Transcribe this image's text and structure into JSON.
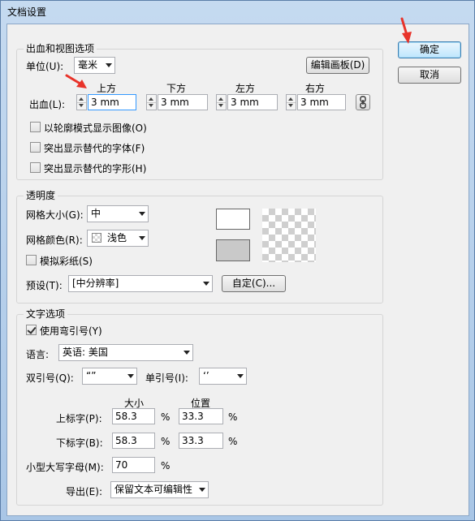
{
  "window": {
    "title": "文档设置"
  },
  "buttons": {
    "ok": "确定",
    "cancel": "取消",
    "edit_artboards": "编辑画板(D)",
    "custom": "自定(C)..."
  },
  "bleed_section": {
    "legend": "出血和视图选项",
    "units_label": "单位(U):",
    "units_value": "毫米",
    "bleed_label": "出血(L):",
    "top_label": "上方",
    "bottom_label": "下方",
    "left_label": "左方",
    "right_label": "右方",
    "top_value": "3 mm",
    "bottom_value": "3 mm",
    "left_value": "3 mm",
    "right_value": "3 mm",
    "outline_images": "以轮廓模式显示图像(O)",
    "highlight_fonts": "突出显示替代的字体(F)",
    "highlight_glyphs": "突出显示替代的字形(H)"
  },
  "transparency_section": {
    "legend": "透明度",
    "grid_size_label": "网格大小(G):",
    "grid_size_value": "中",
    "grid_color_label": "网格颜色(R):",
    "grid_color_value": "浅色",
    "simulate_paper": "模拟彩纸(S)",
    "preset_label": "预设(T):",
    "preset_value": "[中分辨率]"
  },
  "type_section": {
    "legend": "文字选项",
    "use_typographers_quotes": "使用弯引号(Y)",
    "use_typographers_quotes_checked": true,
    "language_label": "语言:",
    "language_value": "英语: 美国",
    "double_quotes_label": "双引号(Q):",
    "double_quotes_value": "“”",
    "single_quotes_label": "单引号(I):",
    "single_quotes_value": "‘’",
    "size_header": "大小",
    "position_header": "位置",
    "superscript_label": "上标字(P):",
    "superscript_size": "58.3",
    "superscript_position": "33.3",
    "subscript_label": "下标字(B):",
    "subscript_size": "58.3",
    "subscript_position": "33.3",
    "small_caps_label": "小型大写字母(M):",
    "small_caps_value": "70",
    "percent": "%",
    "export_label": "导出(E):",
    "export_value": "保留文本可编辑性"
  },
  "colors": {
    "annotation_arrow": "#e8332a",
    "focus_border": "#3399ff"
  }
}
